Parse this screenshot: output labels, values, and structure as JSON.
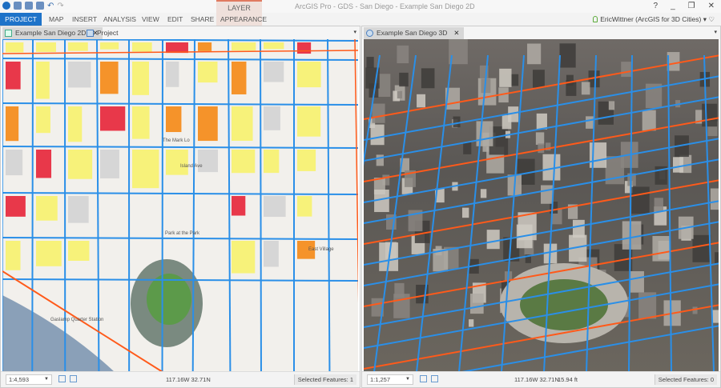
{
  "app": {
    "title": "ArcGIS Pro - GDS - San Diego - Example San Diego 2D",
    "contextual_group": "LAYER",
    "help": "?",
    "minimize": "_",
    "restore": "❐",
    "close": "✕"
  },
  "ribbon": {
    "tabs": [
      "PROJECT",
      "MAP",
      "INSERT",
      "ANALYSIS",
      "VIEW",
      "EDIT",
      "SHARE",
      "APPEARANCE"
    ],
    "active": "PROJECT",
    "user": "EricWittner (ArcGIS for 3D Cities)",
    "user_caret": "▾",
    "heart": "♡"
  },
  "left_pane": {
    "tabs": [
      {
        "label": "Example San Diego 2D",
        "close": "✕"
      },
      {
        "label": "Project"
      }
    ],
    "dropdown": "▾",
    "map_labels": [
      "The Mark Lo",
      "Island Ave",
      "Park at the Park",
      "Gaslamp Quarter Station",
      "East Village"
    ],
    "status": {
      "scale": "1:4,593",
      "coords": "117.16W 32.71N",
      "selected": "Selected Features: 1"
    }
  },
  "right_pane": {
    "tabs": [
      {
        "label": "Example San Diego 3D",
        "close": "✕"
      }
    ],
    "dropdown": "▾",
    "status": {
      "scale": "1:1,257",
      "coords": "117.16W 32.71N",
      "elevation": "15.94 ft",
      "selected": "Selected Features: 0"
    }
  },
  "colors": {
    "accent": "#1e73c9",
    "pipe_blue": "#2a8fe8",
    "pipe_orange": "#ff5a1a",
    "building_yellow": "#f7f27a",
    "building_red": "#e8384a",
    "building_orange": "#f5932a",
    "building_purple": "#a65bd6"
  }
}
